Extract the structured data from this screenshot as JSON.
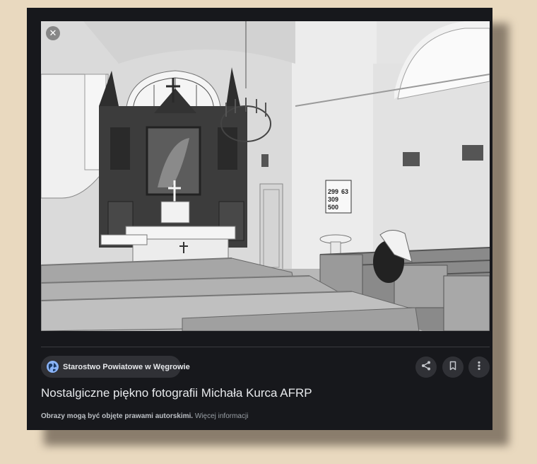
{
  "viewer": {
    "close_label": "✕",
    "source": "Starostwo Powiatowe w Węgrowie",
    "title": "Nostalgiczne piękno fotografii Michała Kurca AFRP",
    "copyright_text": "Obrazy mogą być objęte prawami autorskimi.",
    "more_info_link": "Więcej informacji",
    "actions": [
      "share-icon",
      "bookmark-icon",
      "more-vert-icon"
    ]
  },
  "photo": {
    "hymn_board": [
      "299",
      "63",
      "309",
      "500"
    ]
  },
  "colors": {
    "panel_bg": "#17181c",
    "chip_bg": "#303136",
    "accent": "#8ab4f8",
    "page_bg": "#e9d9bf"
  }
}
